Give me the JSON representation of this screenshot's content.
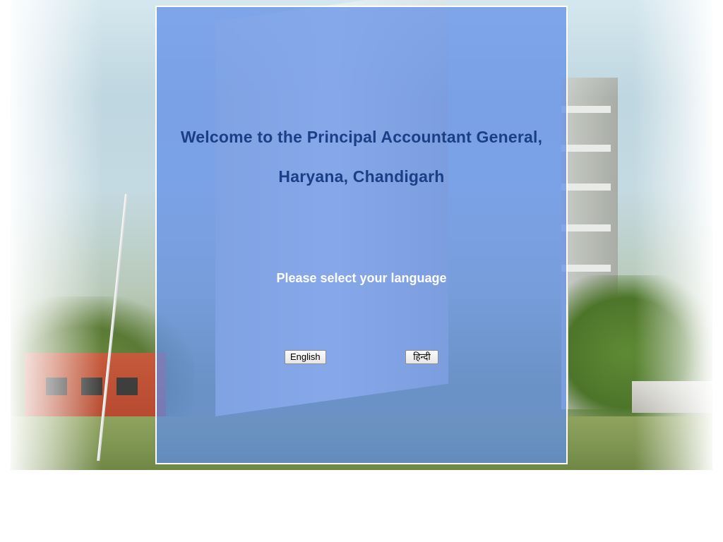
{
  "welcome": {
    "line1": "Welcome to the Principal Accountant General,",
    "line2": "Haryana, Chandigarh"
  },
  "prompt": "Please select your language",
  "buttons": {
    "english": "English",
    "hindi": "हिन्दी"
  },
  "colors": {
    "panel_overlay": "#5e8ce8",
    "heading": "#1b3f86",
    "prompt_text": "#ffffff"
  }
}
